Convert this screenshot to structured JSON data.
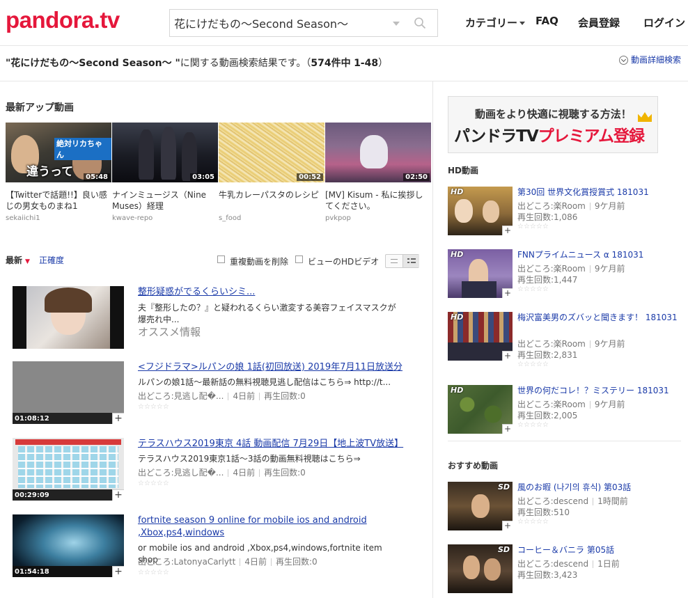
{
  "header": {
    "logo": "pandora.tv",
    "search_value": "花にけだもの〜Second Season〜",
    "nav": {
      "category": "カテゴリー",
      "faq": "FAQ",
      "register": "会員登録",
      "login": "ログイン"
    }
  },
  "results": {
    "query": "\"花にけだもの〜Second Season〜 \"",
    "suffix": "に関する動画検索結果です。（",
    "count": "574件中",
    "range": "1-48",
    "close_paren": "）",
    "advanced_search": "動画詳細検索"
  },
  "latest": {
    "title": "最新アップ動画",
    "items": [
      {
        "title": "【Twitterで話題!!】良い感じの男女ものまね1",
        "user": "sekaiichi1",
        "duration": "05:48",
        "thumb_text": "違うって",
        "thumb_tag": "絶対リカちゃん"
      },
      {
        "title": "ナインミュージス（Nine Muses）経理",
        "user": "kwave-repo",
        "duration": "03:05"
      },
      {
        "title": "牛乳カレーパスタのレシピ",
        "user": "s_food",
        "duration": "00:52"
      },
      {
        "title": "[MV] Kisum - 私に挨拶してください。",
        "user": "pvkpop",
        "duration": "02:50"
      }
    ]
  },
  "sort": {
    "newest": "最新",
    "accuracy": "正確度",
    "remove_duplicates": "重複動画を削除",
    "hd_only": "ビューのHDビデオ"
  },
  "list": [
    {
      "title": "整形疑惑がでるくらいシミ...",
      "desc": "夫『整形したの？』と疑われるくらい激変する美容フェイスマスクが爆売れ中...",
      "tag": "オススメ情報"
    },
    {
      "title": "<フジドラマ>ルパンの娘 1話(初回放送) 2019年7月11日放送分",
      "desc": "ルパンの娘1話〜最新話の無料視聴見逃し配信はこちら⇒ http://t...",
      "source": "出どころ:見逃し配�...",
      "age": "4日前",
      "views": "再生回数:0",
      "duration": "01:08:12",
      "stars": "☆☆☆☆☆"
    },
    {
      "title": "テラスハウス2019東京 4話 動画配信 7月29日【地上波TV放送】",
      "desc": "テラスハウス2019東京1話〜3話の動画無料視聴はこちら⇒",
      "source": "出どころ:見逃し配�...",
      "age": "4日前",
      "views": "再生回数:0",
      "duration": "00:29:09",
      "stars": "☆☆☆☆☆"
    },
    {
      "title": "fortnite season 9 online for mobile ios and android ,Xbox,ps4,windows",
      "desc": "or mobile ios and android ,Xbox,ps4,windows,fortnite item shop",
      "source": "出どころ:LatonyaCarlytt",
      "age": "4日前",
      "views": "再生回数:0",
      "duration": "01:54:18",
      "stars": "☆☆☆☆☆"
    }
  ],
  "sidebar": {
    "banner_top": "動画をより快適に視聴する方法！",
    "banner_bottom_1": "パンドラTV",
    "banner_bottom_2": "プレミアム登録",
    "hd_title": "HD動画",
    "hd_items": [
      {
        "title": "第30回 世界文化賞授賞式 181031",
        "source": "出どころ:楽Room",
        "age": "9ケ月前",
        "views": "再生回数:1,086",
        "badge": "HD",
        "stars": "☆☆☆☆☆"
      },
      {
        "title": "FNNプライムニュース α 181031",
        "source": "出どころ:楽Room",
        "age": "9ケ月前",
        "views": "再生回数:1,447",
        "badge": "HD",
        "stars": "☆☆☆☆☆"
      },
      {
        "title": "梅沢富美男のズバッと聞きます！ 181031",
        "source": "出どころ:楽Room",
        "age": "9ケ月前",
        "views": "再生回数:2,831",
        "badge": "HD",
        "stars": "☆☆☆☆☆"
      },
      {
        "title": "世界の何だコレ！？ミステリー 181031",
        "source": "出どころ:楽Room",
        "age": "9ケ月前",
        "views": "再生回数:2,005",
        "badge": "HD",
        "stars": "☆☆☆☆☆"
      }
    ],
    "rec_title": "おすすめ動画",
    "rec_items": [
      {
        "title": "風のお暇 (나기의 휴식) 第03話",
        "source": "出どころ:descend",
        "age": "1時間前",
        "views": "再生回数:510",
        "badge": "SD",
        "stars": "☆☆☆☆☆"
      },
      {
        "title": "コーヒー＆バニラ 第05話",
        "source": "出どころ:descend",
        "age": "1日前",
        "views": "再生回数:3,423",
        "badge": "SD"
      }
    ]
  },
  "colors": {
    "brand": "#e5173b",
    "link": "#1a3aa8"
  }
}
